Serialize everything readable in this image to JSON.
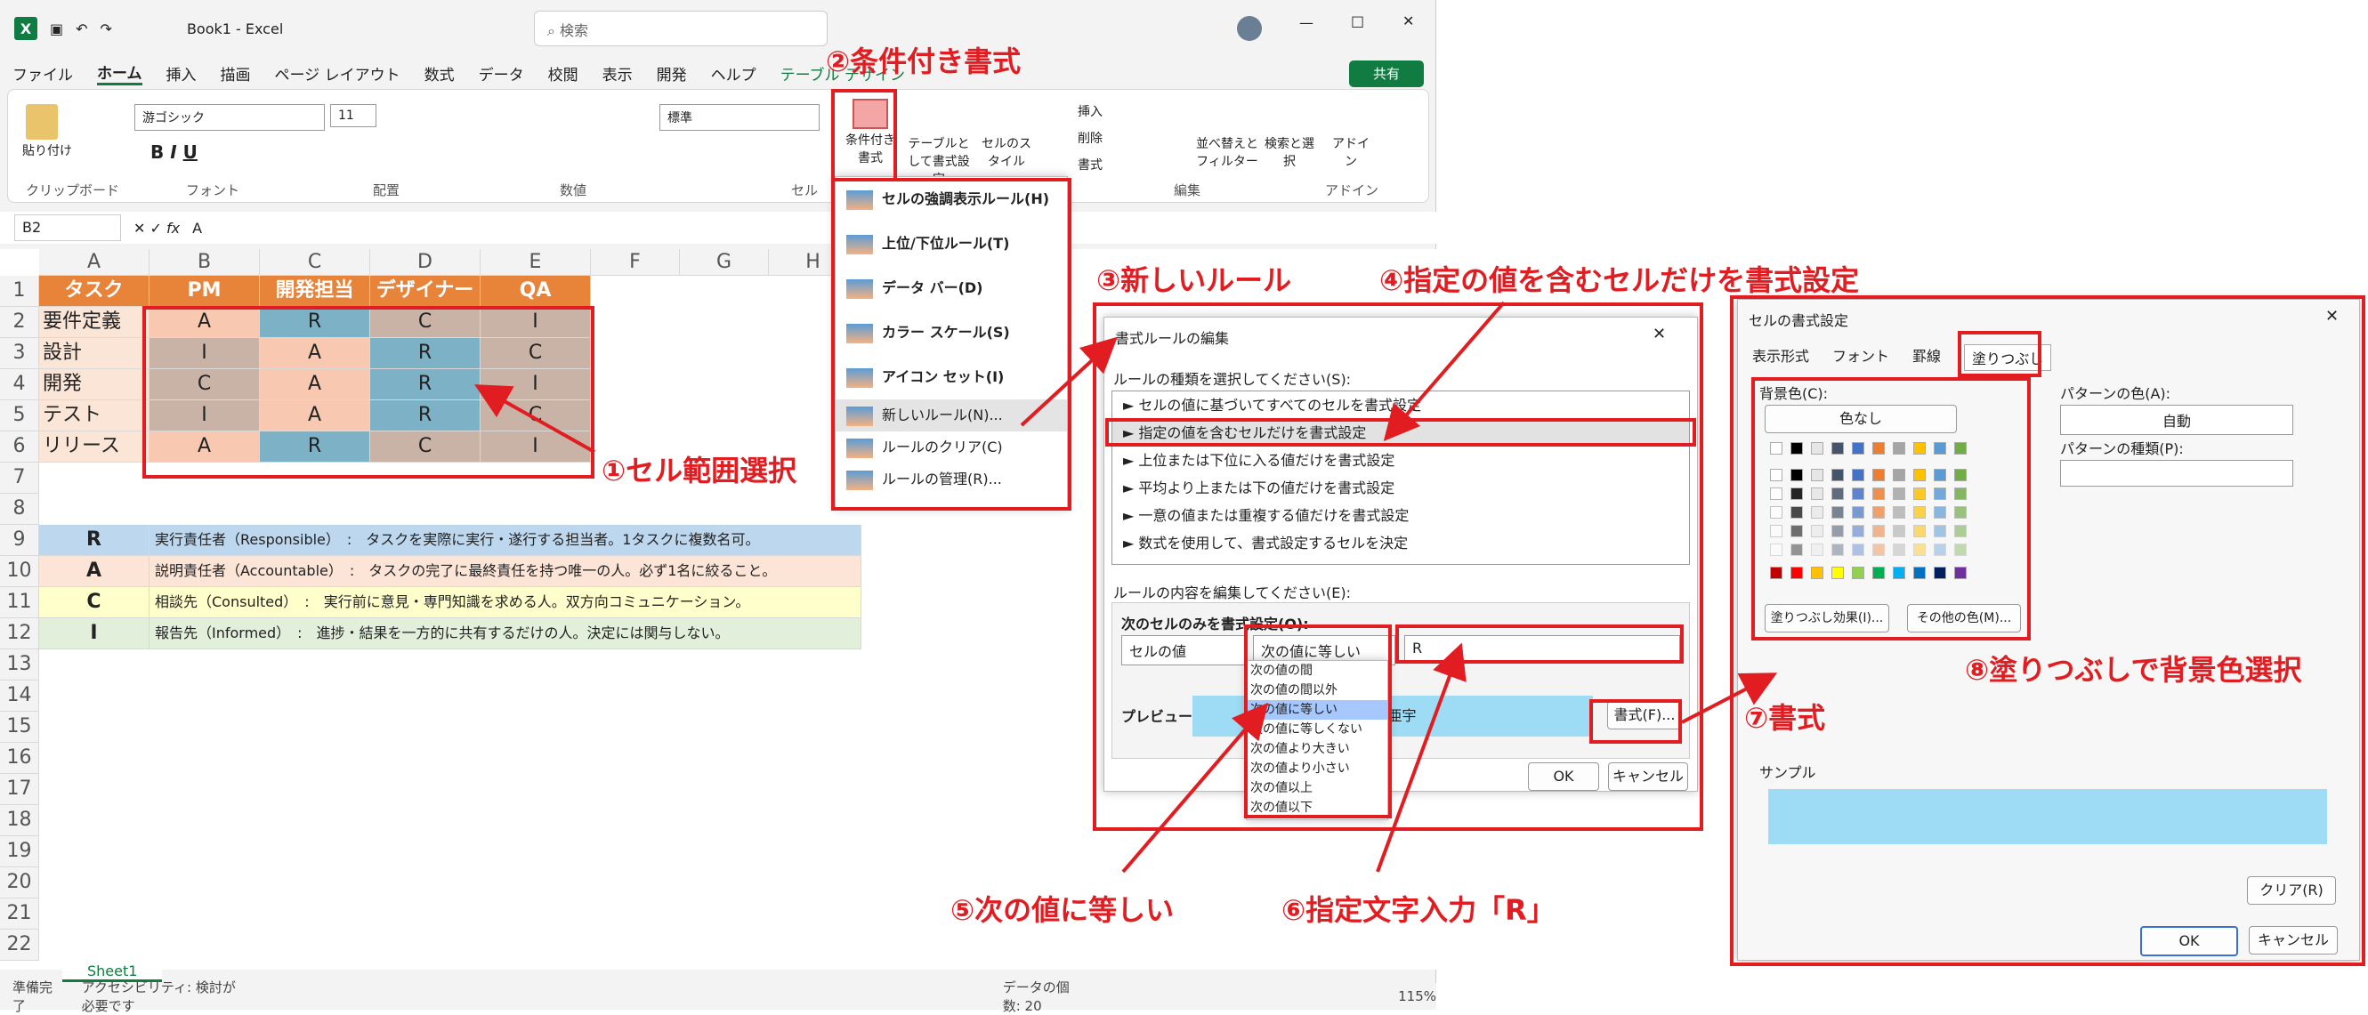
{
  "window": {
    "app": "Book1 - Excel",
    "search": "検索"
  },
  "menu": [
    "ファイル",
    "ホーム",
    "挿入",
    "描画",
    "ページ レイアウト",
    "数式",
    "データ",
    "校閲",
    "表示",
    "開発",
    "ヘルプ",
    "テーブル デザイン"
  ],
  "share": "共有",
  "ribbon": {
    "groups": [
      "クリップボード",
      "フォント",
      "配置",
      "数値",
      "セル",
      "編集",
      "アドイン"
    ],
    "paste": "貼り付け",
    "font": "游ゴシック",
    "size": "11",
    "numfmt": "標準",
    "cf": "条件付き書式",
    "table": "テーブルとして書式設定",
    "style": "セルのスタイル",
    "insert": "挿入",
    "delete": "削除",
    "format": "書式",
    "sort": "並べ替えとフィルター",
    "find": "検索と選択",
    "addin": "アドイン"
  },
  "formula": {
    "name": "B2",
    "value": "A"
  },
  "columns": [
    "A",
    "B",
    "C",
    "D",
    "E",
    "F",
    "G",
    "H"
  ],
  "rows": [
    "1",
    "2",
    "3",
    "4",
    "5",
    "6",
    "7",
    "8",
    "9",
    "10",
    "11",
    "12",
    "13",
    "14",
    "15",
    "16",
    "17",
    "18",
    "19",
    "20",
    "21",
    "22"
  ],
  "header": [
    "タスク",
    "PM",
    "開発担当",
    "デザイナー",
    "QA"
  ],
  "table": [
    [
      "要件定義",
      "A",
      "R",
      "C",
      "I"
    ],
    [
      "設計",
      "I",
      "A",
      "R",
      "C"
    ],
    [
      "開発",
      "C",
      "A",
      "R",
      "I"
    ],
    [
      "テスト",
      "I",
      "A",
      "R",
      "C"
    ],
    [
      "リリース",
      "A",
      "R",
      "C",
      "I"
    ]
  ],
  "legend": [
    {
      "k": "R",
      "d": "実行責任者（Responsible）　:　タスクを実際に実行・遂行する担当者。1タスクに複数名可。",
      "c": "#bdd7ee"
    },
    {
      "k": "A",
      "d": "説明責任者（Accountable）　:　タスクの完了に最終責任を持つ唯一の人。必ず1名に絞ること。",
      "c": "#fce4d6"
    },
    {
      "k": "C",
      "d": "相談先（Consulted）　:　実行前に意見・専門知識を求める人。双方向コミュニケーション。",
      "c": "#ffffcc"
    },
    {
      "k": "I",
      "d": "報告先（Informed）　:　進捗・結果を一方的に共有するだけの人。決定には関与しない。",
      "c": "#e2efda"
    }
  ],
  "sheet": "Sheet1",
  "status": {
    "ready": "準備完了",
    "access": "アクセシビリティ: 検討が必要です",
    "count": "データの個数: 20",
    "zoom": "115%"
  },
  "cfmenu": [
    "セルの強調表示ルール(H)",
    "上位/下位ルール(T)",
    "データ バー(D)",
    "カラー スケール(S)",
    "アイコン セット(I)",
    "新しいルール(N)...",
    "ルールのクリア(C)",
    "ルールの管理(R)..."
  ],
  "rule": {
    "title": "書式ルールの編集",
    "typeLabel": "ルールの種類を選択してください(S):",
    "types": [
      "► セルの値に基づいてすべてのセルを書式設定",
      "► 指定の値を含むセルだけを書式設定",
      "► 上位または下位に入る値だけを書式設定",
      "► 平均より上または下の値だけを書式設定",
      "► 一意の値または重複する値だけを書式設定",
      "► 数式を使用して、書式設定するセルを決定"
    ],
    "editLabel": "ルールの内容を編集してください(E):",
    "onlyLabel": "次のセルのみを書式設定(O):",
    "cellValue": "セルの値",
    "op": "次の値に等しい",
    "value": "R",
    "preview": "プレビュー:",
    "previewText": "ア 亜宇",
    "formatBtn": "書式(F)...",
    "ok": "OK",
    "cancel": "キャンセル",
    "ops": [
      "次の値の間",
      "次の値の間以外",
      "次の値に等しい",
      "次の値に等しくない",
      "次の値より大きい",
      "次の値より小さい",
      "次の値以上",
      "次の値以下"
    ]
  },
  "fmt": {
    "title": "セルの書式設定",
    "tabs": [
      "表示形式",
      "フォント",
      "罫線",
      "塗りつぶし"
    ],
    "bg": "背景色(C):",
    "none": "色なし",
    "patColor": "パターンの色(A):",
    "auto": "自動",
    "patType": "パターンの種類(P):",
    "effect": "塗りつぶし効果(I)...",
    "more": "その他の色(M)...",
    "sample": "サンプル",
    "clear": "クリア(R)",
    "ok": "OK",
    "cancel": "キャンセル",
    "sampleColor": "#9edcf5"
  },
  "callouts": [
    "①セル範囲選択",
    "②条件付き書式",
    "③新しいルール",
    "④指定の値を含むセルだけを書式設定",
    "⑤次の値に等しい",
    "⑥指定文字入力「R」",
    "⑦書式",
    "⑧塗りつぶしで背景色選択"
  ],
  "colors": {
    "R": "#7db1c6",
    "A": "#f8c8b0",
    "C": "#c9b2a6",
    "I": "#c9b2a6",
    "header": "#e8833a",
    "excel": "#107c41",
    "red": "#e11d22"
  }
}
